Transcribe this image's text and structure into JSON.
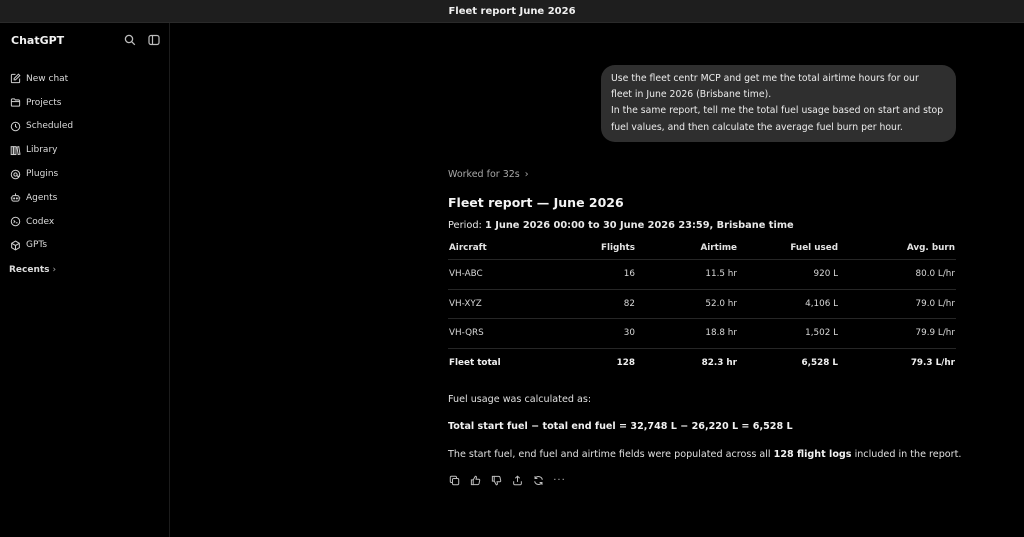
{
  "window": {
    "title": "Fleet report June 2026"
  },
  "sidebar": {
    "brand": "ChatGPT",
    "header_icons": [
      "search-icon",
      "sidebar-toggle-icon"
    ],
    "items": [
      {
        "label": "New chat",
        "icon": "edit-icon"
      },
      {
        "label": "Projects",
        "icon": "folder-icon"
      },
      {
        "label": "Scheduled",
        "icon": "clock-icon"
      },
      {
        "label": "Library",
        "icon": "library-icon"
      },
      {
        "label": "Plugins",
        "icon": "plugins-icon"
      },
      {
        "label": "Agents",
        "icon": "agent-icon"
      },
      {
        "label": "Codex",
        "icon": "codex-icon"
      },
      {
        "label": "GPTs",
        "icon": "gpts-icon"
      }
    ],
    "recents_label": "Recents"
  },
  "conversation": {
    "user_message_lines": [
      "Use the fleet centr MCP and get me the total airtime hours for our",
      "fleet in June 2026 (Brisbane time).",
      "In the same report, tell me the total fuel usage based on start and stop",
      "fuel values, and then calculate the average fuel burn per hour."
    ],
    "worked_for": "Worked for 32s",
    "report": {
      "title": "Fleet report — June 2026",
      "period_label": "Period:",
      "period_value": "1 June 2026 00:00 to 30 June 2026 23:59, Brisbane time",
      "columns": [
        "Aircraft",
        "Flights",
        "Airtime",
        "Fuel used",
        "Avg. burn"
      ],
      "rows": [
        [
          "VH-ABC",
          "16",
          "11.5 hr",
          "920 L",
          "80.0 L/hr"
        ],
        [
          "VH-XYZ",
          "82",
          "52.0 hr",
          "4,106 L",
          "79.0 L/hr"
        ],
        [
          "VH-QRS",
          "30",
          "18.8 hr",
          "1,502 L",
          "79.9 L/hr"
        ]
      ],
      "total": [
        "Fleet total",
        "128",
        "82.3 hr",
        "6,528 L",
        "79.3 L/hr"
      ],
      "calc_label": "Fuel usage was calculated as:",
      "formula": "Total start fuel − total end fuel = 32,748 L − 26,220 L = 6,528 L",
      "note_prefix": "The start fuel, end fuel and airtime fields were populated across all ",
      "note_bold": "128 flight logs",
      "note_suffix": " included in the report."
    },
    "actions": [
      "copy-icon",
      "thumbs-up-icon",
      "thumbs-down-icon",
      "share-icon",
      "regenerate-icon",
      "more-icon"
    ],
    "more_glyph": "···"
  },
  "colors": {
    "background": "#000000",
    "titlebar": "#1e1e1e",
    "bubble": "#2f2f2f",
    "text": "#e8e8e8",
    "muted": "#a8a8a8"
  }
}
